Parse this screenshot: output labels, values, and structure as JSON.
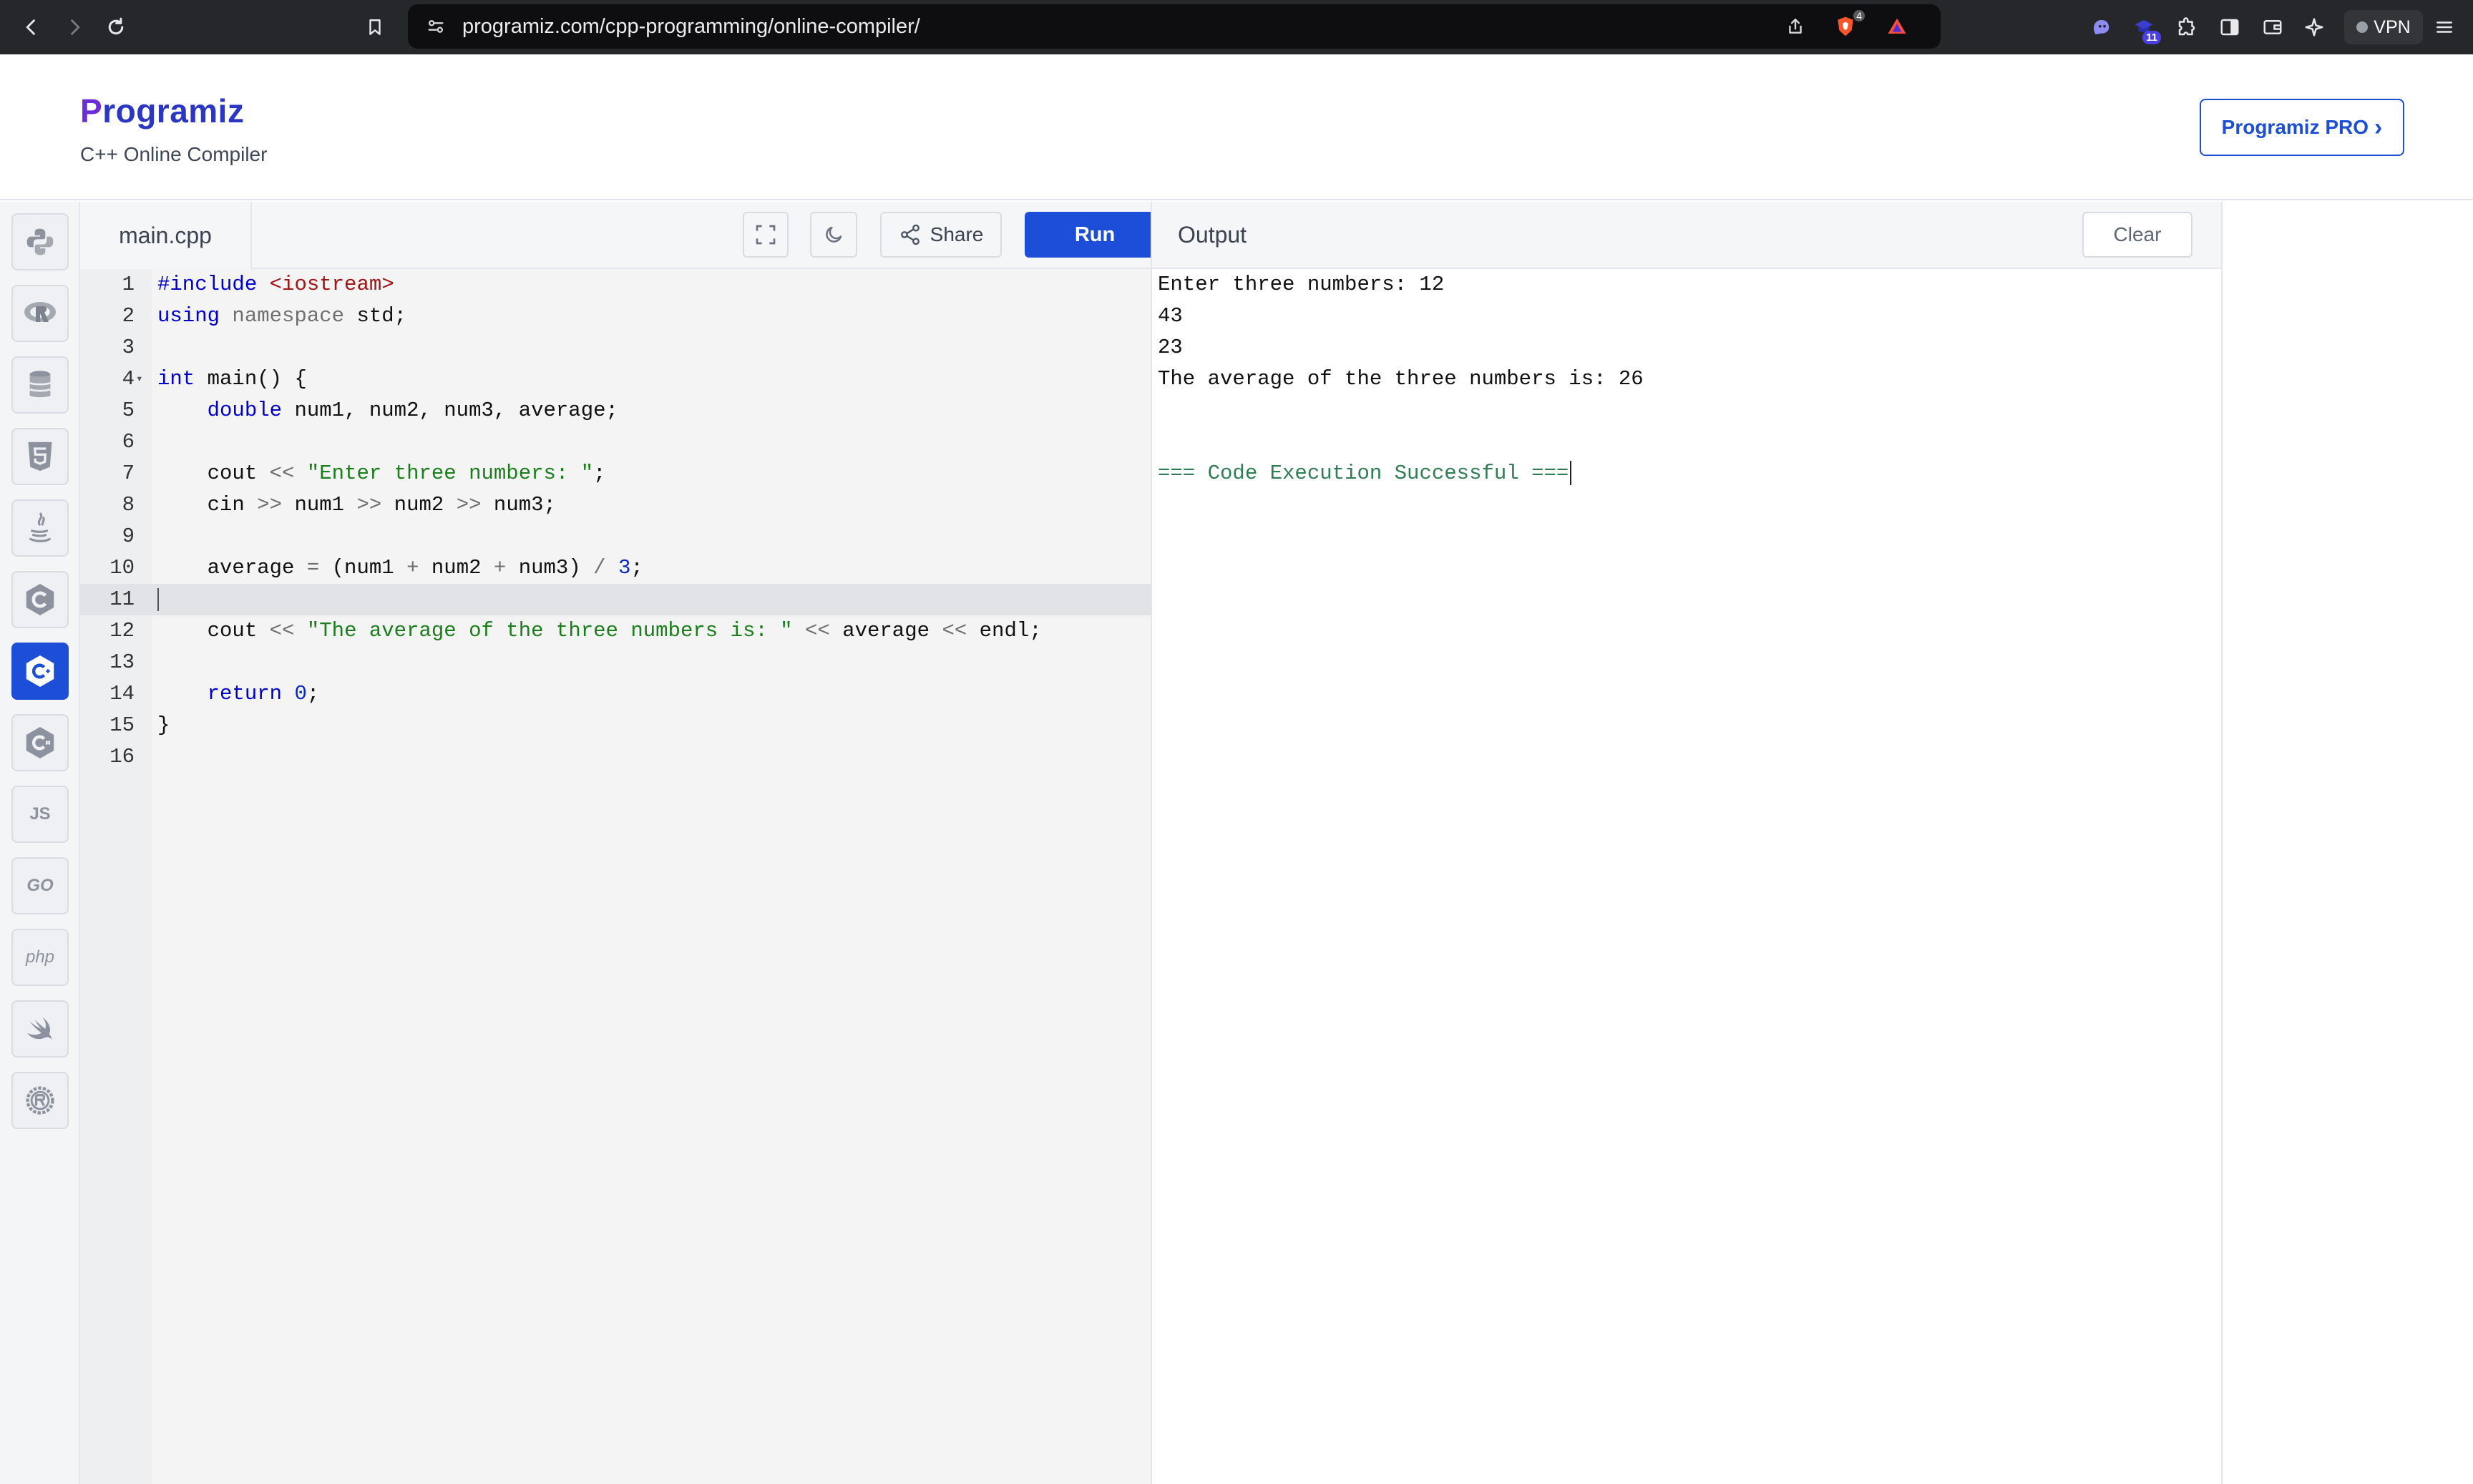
{
  "browser": {
    "url": "programiz.com/cpp-programming/online-compiler/",
    "shields_count": "4",
    "extension_badge": "11",
    "vpn_label": "VPN"
  },
  "site": {
    "logo_text": "rogramiz",
    "logo_mark": "P",
    "subtitle": "C++ Online Compiler",
    "pro_button": "Programiz PRO",
    "pro_chevron": "›"
  },
  "sidebar": {
    "languages": [
      {
        "name": "python",
        "glyph": ""
      },
      {
        "name": "r",
        "glyph": ""
      },
      {
        "name": "sql",
        "glyph": ""
      },
      {
        "name": "html",
        "glyph": ""
      },
      {
        "name": "java",
        "glyph": ""
      },
      {
        "name": "c",
        "glyph": ""
      },
      {
        "name": "cpp",
        "glyph": "",
        "active": true
      },
      {
        "name": "csharp",
        "glyph": ""
      },
      {
        "name": "javascript",
        "glyph": "JS"
      },
      {
        "name": "go",
        "glyph": "GO"
      },
      {
        "name": "php",
        "glyph": "php"
      },
      {
        "name": "swift",
        "glyph": ""
      },
      {
        "name": "rust",
        "glyph": ""
      }
    ]
  },
  "editor": {
    "file_name": "main.cpp",
    "share_label": "Share",
    "run_label": "Run",
    "active_line": 11,
    "lines": [
      {
        "n": "1",
        "text": "#include <iostream>"
      },
      {
        "n": "2",
        "text": "using namespace std;"
      },
      {
        "n": "3",
        "text": ""
      },
      {
        "n": "4",
        "text": "int main() {"
      },
      {
        "n": "5",
        "text": "    double num1, num2, num3, average;"
      },
      {
        "n": "6",
        "text": ""
      },
      {
        "n": "7",
        "text": "    cout << \"Enter three numbers: \";"
      },
      {
        "n": "8",
        "text": "    cin >> num1 >> num2 >> num3;"
      },
      {
        "n": "9",
        "text": ""
      },
      {
        "n": "10",
        "text": "    average = (num1 + num2 + num3) / 3;"
      },
      {
        "n": "11",
        "text": ""
      },
      {
        "n": "12",
        "text": "    cout << \"The average of the three numbers is: \" << average << endl;"
      },
      {
        "n": "13",
        "text": ""
      },
      {
        "n": "14",
        "text": "    return 0;"
      },
      {
        "n": "15",
        "text": "}"
      },
      {
        "n": "16",
        "text": ""
      }
    ]
  },
  "output": {
    "title": "Output",
    "clear_label": "Clear",
    "lines": [
      "Enter three numbers: 12",
      "43",
      "23",
      "The average of the three numbers is: 26",
      "",
      "",
      "=== Code Execution Successful ==="
    ]
  },
  "colors": {
    "accent": "#1d4ed8",
    "success": "#2f7d52",
    "toolbar": "#26272b"
  }
}
